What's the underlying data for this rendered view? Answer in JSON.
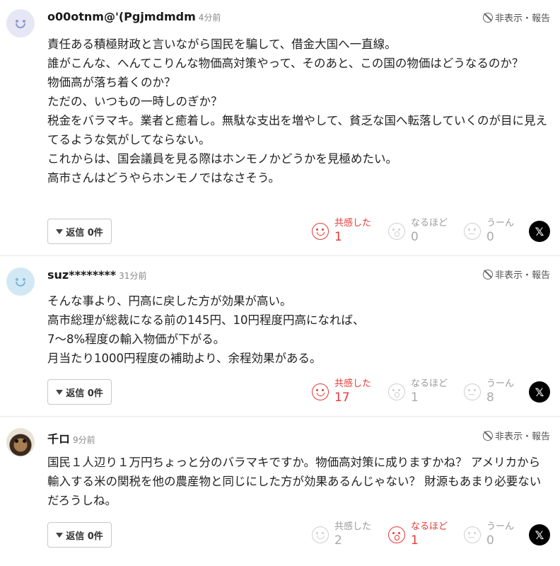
{
  "ui": {
    "hide_report": "非表示・報告",
    "reply": "返信 0件",
    "reactions": [
      "共感した",
      "なるほど",
      "うーん"
    ],
    "x_glyph": "𝕏"
  },
  "comments": [
    {
      "author": "o00otnm@'(Pgjmdmdm",
      "time": "4分前",
      "lines": [
        "責任ある積極財政と言いながら国民を騙して、借金大国へ一直線。",
        "誰がこんな、へんてこりんな物価高対策やって、そのあと、この国の物価はどうなるのか？",
        "物価高が落ち着くのか？",
        "ただの、いつもの一時しのぎか？",
        "税金をバラマキ。業者と癒着し。無駄な支出を増やして、貧乏な国へ転落していくのが目に見えてるような気がしてならない。",
        "これからは、国会議員を見る際はホンモノかどうかを見極めたい。",
        "高市さんはどうやらホンモノではなさそう。"
      ],
      "counts": [
        "1",
        "0",
        "0"
      ],
      "active": 0
    },
    {
      "author": "suz********",
      "time": "31分前",
      "lines": [
        "そんな事より、円高に戻した方が効果が高い。",
        "高市総理が総裁になる前の145円、10円程度円高になれば、",
        "7〜8%程度の輸入物価が下がる。",
        "月当たり1000円程度の補助より、余程効果がある。"
      ],
      "counts": [
        "17",
        "1",
        "8"
      ],
      "active": 0
    },
    {
      "author": "千ロ",
      "time": "9分前",
      "lines": [
        "国民１人辺り１万円ちょっと分のバラマキですか。物価高対策に成りますかね？ アメリカから輸入する米の関税を他の農産物と同じにした方が効果あるんじゃない？ 財源もあまり必要ないだろうしね。"
      ],
      "counts": [
        "2",
        "1",
        "0"
      ],
      "active": 1
    }
  ]
}
